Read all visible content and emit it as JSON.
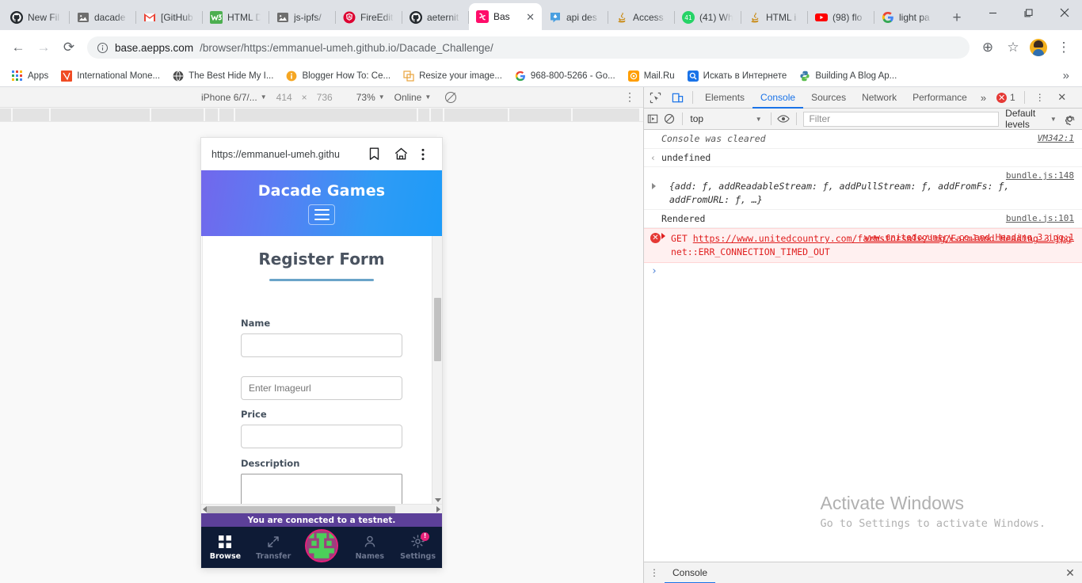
{
  "browser": {
    "tabs": [
      {
        "label": "New Fil",
        "icon": "github-icon",
        "active": false
      },
      {
        "label": "dacade",
        "icon": "broken-image-icon",
        "active": false
      },
      {
        "label": "[GitHub",
        "icon": "gmail-icon",
        "active": false
      },
      {
        "label": "HTML D",
        "icon": "w3schools-icon",
        "active": false
      },
      {
        "label": "js-ipfs/",
        "icon": "broken-image-icon",
        "active": false
      },
      {
        "label": "FireEdit",
        "icon": "angular-icon",
        "active": false
      },
      {
        "label": "aeternit",
        "icon": "github-icon",
        "active": false
      },
      {
        "label": "Bas",
        "icon": "base-aepps-icon",
        "active": true
      },
      {
        "label": "api des",
        "icon": "eth-icon",
        "active": false
      },
      {
        "label": "Access",
        "icon": "java-icon",
        "active": false
      },
      {
        "label": "(41) Wh",
        "icon": "whatsapp-icon",
        "active": false
      },
      {
        "label": "HTML i",
        "icon": "java-icon",
        "active": false
      },
      {
        "label": "(98) flo",
        "icon": "youtube-icon",
        "active": false
      },
      {
        "label": "light pa",
        "icon": "google-icon",
        "active": false
      }
    ],
    "new_tab_label": "+",
    "close_tab_label": "✕",
    "window_controls": {
      "minimize": "—",
      "maximize": "❐",
      "close": "✕"
    },
    "nav": {
      "back": "←",
      "forward": "→",
      "reload": "⟳"
    },
    "address": {
      "security_icon": "info-circle-icon",
      "host": "base.aepps.com",
      "path": "/browser/https:/emmanuel-umeh.github.io/Dacade_Challenge/"
    },
    "omnibox_actions": {
      "install": "⊕",
      "bookmark": "☆",
      "menu": "⋮"
    },
    "bookmarks": [
      {
        "label": "Apps",
        "icon": "apps-grid-icon"
      },
      {
        "label": "International Mone...",
        "icon": "orange-square-icon"
      },
      {
        "label": "The Best Hide My I...",
        "icon": "globe-icon"
      },
      {
        "label": "Blogger How To: Ce...",
        "icon": "info-orange-icon"
      },
      {
        "label": "Resize your image...",
        "icon": "resize-icon"
      },
      {
        "label": "968-800-5266 - Go...",
        "icon": "google-icon"
      },
      {
        "label": "Mail.Ru",
        "icon": "mailru-icon"
      },
      {
        "label": "Искать в Интернете",
        "icon": "search-blue-icon"
      },
      {
        "label": "Building A Blog Ap...",
        "icon": "python-icon"
      }
    ],
    "bookmarks_overflow": "»"
  },
  "device_toolbar": {
    "device": "iPhone 6/7/...",
    "width": "414",
    "times": "×",
    "height": "736",
    "zoom": "73%",
    "throttle": "Online",
    "rotate_icon": "rotate-disabled-icon",
    "kebab": "⋮"
  },
  "phone": {
    "url": "https://emmanuel-umeh.githu",
    "bookmark_icon": "bookmark-icon",
    "home_icon": "home-icon",
    "menu_icon": "kebab-menu-icon",
    "app": {
      "title": "Dacade Games",
      "menu_icon": "hamburger-icon",
      "form_title": "Register Form",
      "fields": [
        {
          "label": "Name",
          "type": "input",
          "value": "",
          "placeholder": ""
        },
        {
          "label": "",
          "type": "input",
          "value": "",
          "placeholder": "Enter Imageurl"
        },
        {
          "label": "Price",
          "type": "input",
          "value": "",
          "placeholder": ""
        },
        {
          "label": "Description",
          "type": "textarea",
          "value": "",
          "placeholder": ""
        }
      ]
    },
    "testnet_notice": "You are connected to a testnet.",
    "bottom_nav": [
      {
        "label": "Browse",
        "icon": "grid-icon",
        "active": true
      },
      {
        "label": "Transfer",
        "icon": "arrows-diagonal-icon",
        "active": false
      },
      {
        "label": "Names",
        "icon": "person-icon",
        "active": false
      },
      {
        "label": "Settings",
        "icon": "gear-icon",
        "active": false,
        "badge": "!"
      }
    ],
    "avatar": {
      "icon": "identicon-avatar",
      "colors": [
        "#e6217a",
        "#4ccf5a",
        "#8e3c75"
      ]
    }
  },
  "devtools": {
    "inspect_icon": "inspect-cursor-icon",
    "device_toggle_icon": "device-toolbar-icon",
    "tabs": [
      {
        "label": "Elements",
        "selected": false
      },
      {
        "label": "Console",
        "selected": true
      },
      {
        "label": "Sources",
        "selected": false
      },
      {
        "label": "Network",
        "selected": false
      },
      {
        "label": "Performance",
        "selected": false
      }
    ],
    "more_tabs": "»",
    "error_count": "1",
    "error_badge_glyph": "✕",
    "kebab": "⋮",
    "close": "✕",
    "filterbar": {
      "execute_icon": "execute-snippet-icon",
      "clear_icon": "clear-console-icon",
      "context": "top",
      "eye_icon": "live-expression-icon",
      "filter_placeholder": "Filter",
      "levels": "Default levels",
      "settings_icon": "gear-icon"
    },
    "console": [
      {
        "kind": "info",
        "text": "Console was cleared",
        "source": "VM342:1"
      },
      {
        "kind": "result",
        "text": "undefined",
        "source": ""
      },
      {
        "kind": "object",
        "text": "{add: ƒ, addReadableStream: ƒ, addPullStream: ƒ, addFromFs: ƒ, addFromURL: ƒ, …}",
        "source": "bundle.js:148"
      },
      {
        "kind": "log",
        "text": "Rendered",
        "source": "bundle.js:101"
      },
      {
        "kind": "error",
        "method": "GET",
        "url": "https://www.unitedcountry.com/farmsforsale/img/Farmland Heading 3.jpg",
        "status": "net::ERR_CONNECTION_TIMED_OUT",
        "source": "www.unitedcountry.co…and Heading 3.jpg:1"
      }
    ],
    "prompt_glyph": "›",
    "drawer": {
      "kebab": "⋮",
      "tab": "Console",
      "close": "✕"
    }
  },
  "watermark": {
    "line1": "Activate Windows",
    "line2": "Go to Settings to activate Windows."
  },
  "colors": {
    "accent_blue": "#1a73e8",
    "error_red": "#e02020",
    "app_gradient_start": "#7267ec",
    "app_gradient_end": "#1d9bf8",
    "testnet_purple": "#5c4099",
    "bottom_nav_navy": "#0e1b36",
    "avatar_pink": "#e6217a"
  }
}
